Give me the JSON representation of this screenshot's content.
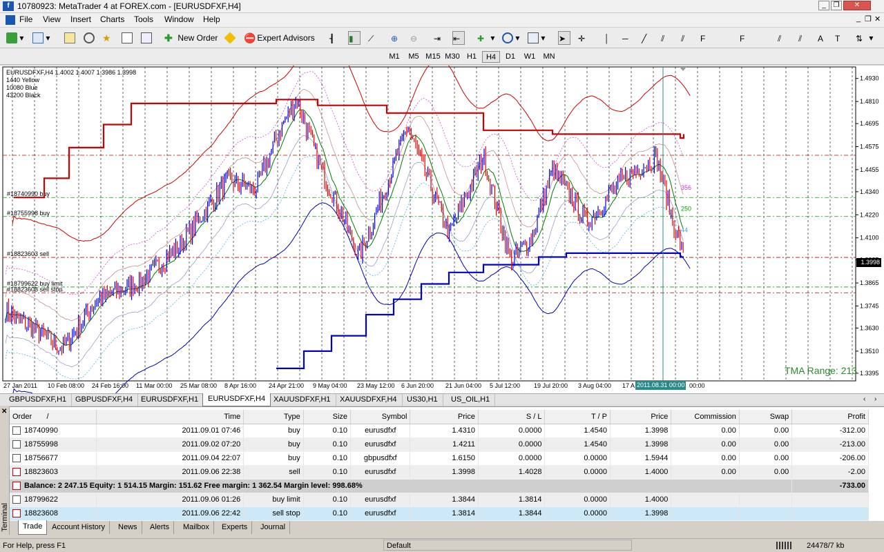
{
  "window": {
    "title": "10780923: MetaTrader 4 at FOREX.com - [EURUSDFXF,H4]"
  },
  "menu": [
    "File",
    "View",
    "Insert",
    "Charts",
    "Tools",
    "Window",
    "Help"
  ],
  "toolbar": {
    "new_order": "New Order",
    "expert_advisors": "Expert Advisors"
  },
  "timeframes": [
    "M1",
    "M5",
    "M15",
    "M30",
    "H1",
    "H4",
    "D1",
    "W1",
    "MN"
  ],
  "active_timeframe": "H4",
  "chart": {
    "header": "EURUSDFXF,H4  1.4002 1.4007 1.3986 1.3998",
    "legend": [
      "1440 Yellow",
      "10080 Blue",
      "43200 Black"
    ],
    "current_price": "1.3998",
    "range_label": "TMA Range: 213",
    "selected_date": "2011.08.31 00:00",
    "price_ticks": [
      "1.4930",
      "1.4810",
      "1.4695",
      "1.4575",
      "1.4455",
      "1.4340",
      "1.4220",
      "1.4100",
      "1.3985",
      "1.3865",
      "1.3745",
      "1.3630",
      "1.3510",
      "1.3395"
    ],
    "time_ticks": [
      "27 Jan 2011",
      "10 Feb 08:00",
      "24 Feb 16:00",
      "11 Mar 00:00",
      "25 Mar 08:00",
      "8 Apr 16:00",
      "24 Apr 21:00",
      "9 May 04:00",
      "23 May 12:00",
      "6 Jun 20:00",
      "21 Jun 04:00",
      "5 Jul 12:00",
      "19 Jul 20:00",
      "3 Aug 04:00",
      "17 A",
      "00:00"
    ],
    "order_lines": [
      {
        "label": "#18740990 buy",
        "price": 1.431,
        "color": "#00a000"
      },
      {
        "label": "#18755998 buy",
        "price": 1.4211,
        "color": "#00a000"
      },
      {
        "label": "#18823603 sell",
        "price": 1.3998,
        "color": "#c00000"
      },
      {
        "label": "#18799622 buy limit",
        "price": 1.3844,
        "color": "#00a000"
      },
      {
        "label": "#18823608 sell stop",
        "price": 1.3814,
        "color": "#c00000"
      }
    ],
    "band_labels": [
      {
        "text": "356",
        "color": "#cc33cc"
      },
      {
        "text": "250",
        "color": "#00a000"
      },
      {
        "text": "44",
        "color": "#33aadd"
      }
    ]
  },
  "chart_tabs": [
    "GBPUSDFXF,H1",
    "GBPUSDFXF,H4",
    "EURUSDFXF,H1",
    "EURUSDFXF,H4",
    "XAUUSDFXF,H1",
    "XAUUSDFXF,H4",
    "US30,H1",
    "US_OIL,H1"
  ],
  "active_chart_tab": "EURUSDFXF,H4",
  "terminal": {
    "side_label": "Terminal",
    "columns": [
      "Order",
      "Time",
      "Type",
      "Size",
      "Symbol",
      "Price",
      "S / L",
      "T / P",
      "Price",
      "Commission",
      "Swap",
      "Profit"
    ],
    "sort_indicator": "/",
    "orders": [
      {
        "order": "18740990",
        "time": "2011.09.01 07:46",
        "type": "buy",
        "size": "0.10",
        "symbol": "eurusdfxf",
        "price": "1.4310",
        "sl": "0.0000",
        "tp": "1.4540",
        "cur": "1.3998",
        "commission": "0.00",
        "swap": "0.00",
        "profit": "-312.00"
      },
      {
        "order": "18755998",
        "time": "2011.09.02 07:20",
        "type": "buy",
        "size": "0.10",
        "symbol": "eurusdfxf",
        "price": "1.4211",
        "sl": "0.0000",
        "tp": "1.4540",
        "cur": "1.3998",
        "commission": "0.00",
        "swap": "0.00",
        "profit": "-213.00"
      },
      {
        "order": "18756677",
        "time": "2011.09.04 22:07",
        "type": "buy",
        "size": "0.10",
        "symbol": "gbpusdfxf",
        "price": "1.6150",
        "sl": "0.0000",
        "tp": "0.0000",
        "cur": "1.5944",
        "commission": "0.00",
        "swap": "0.00",
        "profit": "-206.00"
      },
      {
        "order": "18823603",
        "time": "2011.09.06 22:38",
        "type": "sell",
        "size": "0.10",
        "symbol": "eurusdfxf",
        "price": "1.3998",
        "sl": "1.4028",
        "tp": "0.0000",
        "cur": "1.4000",
        "commission": "0.00",
        "swap": "0.00",
        "profit": "-2.00"
      }
    ],
    "balance_line": "Balance: 2 247.15  Equity: 1 514.15  Margin: 151.62  Free margin: 1 362.54  Margin level: 998.68%",
    "balance_profit": "-733.00",
    "pending": [
      {
        "order": "18799622",
        "time": "2011.09.06 01:26",
        "type": "buy limit",
        "size": "0.10",
        "symbol": "eurusdfxf",
        "price": "1.3844",
        "sl": "1.3814",
        "tp": "0.0000",
        "cur": "1.4000"
      },
      {
        "order": "18823608",
        "time": "2011.09.06 22:42",
        "type": "sell stop",
        "size": "0.10",
        "symbol": "eurusdfxf",
        "price": "1.3814",
        "sl": "1.3844",
        "tp": "0.0000",
        "cur": "1.3998"
      }
    ],
    "tabs": [
      "Trade",
      "Account History",
      "News",
      "Alerts",
      "Mailbox",
      "Experts",
      "Journal"
    ],
    "active_tab": "Trade"
  },
  "status": {
    "help": "For Help, press F1",
    "profile": "Default",
    "traffic": "24478/7 kb"
  }
}
